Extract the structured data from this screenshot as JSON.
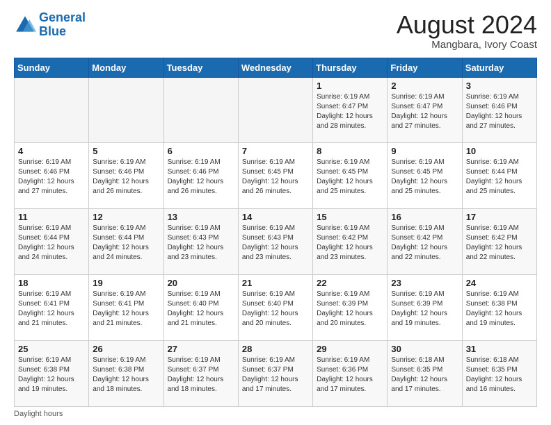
{
  "header": {
    "logo_line1": "General",
    "logo_line2": "Blue",
    "month_year": "August 2024",
    "location": "Mangbara, Ivory Coast"
  },
  "footer": {
    "daylight_label": "Daylight hours"
  },
  "weekdays": [
    "Sunday",
    "Monday",
    "Tuesday",
    "Wednesday",
    "Thursday",
    "Friday",
    "Saturday"
  ],
  "weeks": [
    [
      {
        "day": "",
        "info": ""
      },
      {
        "day": "",
        "info": ""
      },
      {
        "day": "",
        "info": ""
      },
      {
        "day": "",
        "info": ""
      },
      {
        "day": "1",
        "info": "Sunrise: 6:19 AM\nSunset: 6:47 PM\nDaylight: 12 hours\nand 28 minutes."
      },
      {
        "day": "2",
        "info": "Sunrise: 6:19 AM\nSunset: 6:47 PM\nDaylight: 12 hours\nand 27 minutes."
      },
      {
        "day": "3",
        "info": "Sunrise: 6:19 AM\nSunset: 6:46 PM\nDaylight: 12 hours\nand 27 minutes."
      }
    ],
    [
      {
        "day": "4",
        "info": "Sunrise: 6:19 AM\nSunset: 6:46 PM\nDaylight: 12 hours\nand 27 minutes."
      },
      {
        "day": "5",
        "info": "Sunrise: 6:19 AM\nSunset: 6:46 PM\nDaylight: 12 hours\nand 26 minutes."
      },
      {
        "day": "6",
        "info": "Sunrise: 6:19 AM\nSunset: 6:46 PM\nDaylight: 12 hours\nand 26 minutes."
      },
      {
        "day": "7",
        "info": "Sunrise: 6:19 AM\nSunset: 6:45 PM\nDaylight: 12 hours\nand 26 minutes."
      },
      {
        "day": "8",
        "info": "Sunrise: 6:19 AM\nSunset: 6:45 PM\nDaylight: 12 hours\nand 25 minutes."
      },
      {
        "day": "9",
        "info": "Sunrise: 6:19 AM\nSunset: 6:45 PM\nDaylight: 12 hours\nand 25 minutes."
      },
      {
        "day": "10",
        "info": "Sunrise: 6:19 AM\nSunset: 6:44 PM\nDaylight: 12 hours\nand 25 minutes."
      }
    ],
    [
      {
        "day": "11",
        "info": "Sunrise: 6:19 AM\nSunset: 6:44 PM\nDaylight: 12 hours\nand 24 minutes."
      },
      {
        "day": "12",
        "info": "Sunrise: 6:19 AM\nSunset: 6:44 PM\nDaylight: 12 hours\nand 24 minutes."
      },
      {
        "day": "13",
        "info": "Sunrise: 6:19 AM\nSunset: 6:43 PM\nDaylight: 12 hours\nand 23 minutes."
      },
      {
        "day": "14",
        "info": "Sunrise: 6:19 AM\nSunset: 6:43 PM\nDaylight: 12 hours\nand 23 minutes."
      },
      {
        "day": "15",
        "info": "Sunrise: 6:19 AM\nSunset: 6:42 PM\nDaylight: 12 hours\nand 23 minutes."
      },
      {
        "day": "16",
        "info": "Sunrise: 6:19 AM\nSunset: 6:42 PM\nDaylight: 12 hours\nand 22 minutes."
      },
      {
        "day": "17",
        "info": "Sunrise: 6:19 AM\nSunset: 6:42 PM\nDaylight: 12 hours\nand 22 minutes."
      }
    ],
    [
      {
        "day": "18",
        "info": "Sunrise: 6:19 AM\nSunset: 6:41 PM\nDaylight: 12 hours\nand 21 minutes."
      },
      {
        "day": "19",
        "info": "Sunrise: 6:19 AM\nSunset: 6:41 PM\nDaylight: 12 hours\nand 21 minutes."
      },
      {
        "day": "20",
        "info": "Sunrise: 6:19 AM\nSunset: 6:40 PM\nDaylight: 12 hours\nand 21 minutes."
      },
      {
        "day": "21",
        "info": "Sunrise: 6:19 AM\nSunset: 6:40 PM\nDaylight: 12 hours\nand 20 minutes."
      },
      {
        "day": "22",
        "info": "Sunrise: 6:19 AM\nSunset: 6:39 PM\nDaylight: 12 hours\nand 20 minutes."
      },
      {
        "day": "23",
        "info": "Sunrise: 6:19 AM\nSunset: 6:39 PM\nDaylight: 12 hours\nand 19 minutes."
      },
      {
        "day": "24",
        "info": "Sunrise: 6:19 AM\nSunset: 6:38 PM\nDaylight: 12 hours\nand 19 minutes."
      }
    ],
    [
      {
        "day": "25",
        "info": "Sunrise: 6:19 AM\nSunset: 6:38 PM\nDaylight: 12 hours\nand 19 minutes."
      },
      {
        "day": "26",
        "info": "Sunrise: 6:19 AM\nSunset: 6:38 PM\nDaylight: 12 hours\nand 18 minutes."
      },
      {
        "day": "27",
        "info": "Sunrise: 6:19 AM\nSunset: 6:37 PM\nDaylight: 12 hours\nand 18 minutes."
      },
      {
        "day": "28",
        "info": "Sunrise: 6:19 AM\nSunset: 6:37 PM\nDaylight: 12 hours\nand 17 minutes."
      },
      {
        "day": "29",
        "info": "Sunrise: 6:19 AM\nSunset: 6:36 PM\nDaylight: 12 hours\nand 17 minutes."
      },
      {
        "day": "30",
        "info": "Sunrise: 6:18 AM\nSunset: 6:35 PM\nDaylight: 12 hours\nand 17 minutes."
      },
      {
        "day": "31",
        "info": "Sunrise: 6:18 AM\nSunset: 6:35 PM\nDaylight: 12 hours\nand 16 minutes."
      }
    ]
  ]
}
